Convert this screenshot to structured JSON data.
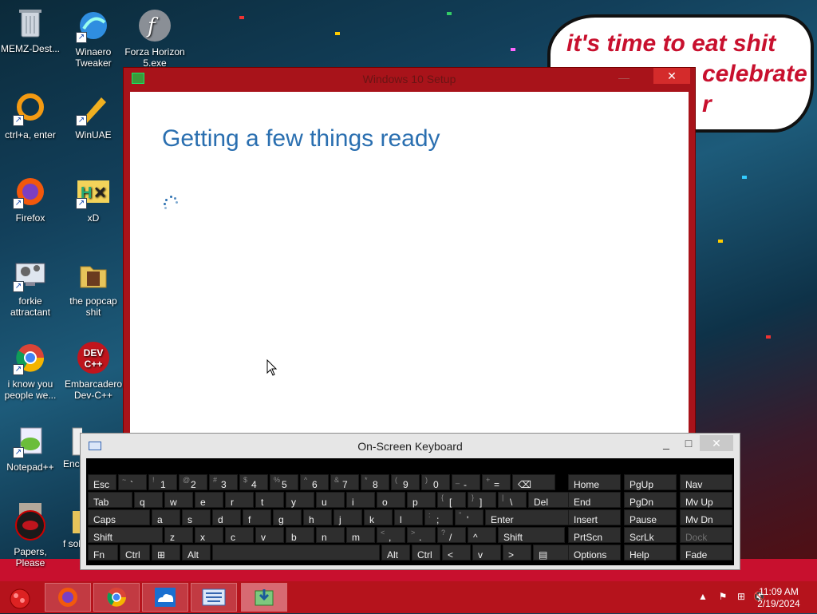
{
  "wallpaper": {
    "speech_bubble_text": "it's time to eat shit and celebrate",
    "speech_bubble_line1": "it's time to eat shit",
    "speech_bubble_line2": "celebrate",
    "speech_bubble_line3": "r"
  },
  "desktop_icons": [
    {
      "label": "MEMZ-Dest...",
      "icon": "recycle-bin-icon"
    },
    {
      "label": "Winaero Tweaker",
      "icon": "winaero-icon"
    },
    {
      "label": "Forza Horizon 5.exe",
      "icon": "flash-icon"
    },
    {
      "label": "ctrl+a, enter",
      "icon": "orange-ring-icon"
    },
    {
      "label": "WinUAE",
      "icon": "pencil-icon"
    },
    {
      "label": "Firefox",
      "icon": "firefox-icon"
    },
    {
      "label": "xD",
      "icon": "hxd-icon"
    },
    {
      "label": "forkie attractant",
      "icon": "settings-monitor-icon"
    },
    {
      "label": "the popcap shit",
      "icon": "folder-icon"
    },
    {
      "label": "i know you people we...",
      "icon": "chrome-icon"
    },
    {
      "label": "Embarcadero Dev-C++",
      "icon": "devcpp-icon"
    },
    {
      "label": "Notepad++",
      "icon": "notepadpp-icon"
    },
    {
      "label": "Enc",
      "icon": "document-icon"
    },
    {
      "label": "Papers, Please",
      "icon": "papers-please-icon"
    },
    {
      "label": "f sol",
      "icon": "folder-icon"
    }
  ],
  "setup_window": {
    "title": "Windows 10 Setup",
    "heading": "Getting a few things ready",
    "close_symbol": "✕",
    "minimize_symbol": "—"
  },
  "osk": {
    "title": "On-Screen Keyboard",
    "minimize_symbol": "_",
    "maximize_symbol": "□",
    "close_symbol": "✕",
    "row1": [
      {
        "main": "Esc"
      },
      {
        "sub": "~",
        "main": "`"
      },
      {
        "sub": "!",
        "main": "1"
      },
      {
        "sub": "@",
        "main": "2"
      },
      {
        "sub": "#",
        "main": "3"
      },
      {
        "sub": "$",
        "main": "4"
      },
      {
        "sub": "%",
        "main": "5"
      },
      {
        "sub": "^",
        "main": "6"
      },
      {
        "sub": "&",
        "main": "7"
      },
      {
        "sub": "*",
        "main": "8"
      },
      {
        "sub": "(",
        "main": "9"
      },
      {
        "sub": ")",
        "main": "0"
      },
      {
        "sub": "_",
        "main": "-"
      },
      {
        "sub": "+",
        "main": "="
      },
      {
        "main": "⌫"
      }
    ],
    "row2": [
      {
        "main": "Tab"
      },
      {
        "main": "q"
      },
      {
        "main": "w"
      },
      {
        "main": "e"
      },
      {
        "main": "r"
      },
      {
        "main": "t"
      },
      {
        "main": "y"
      },
      {
        "main": "u"
      },
      {
        "main": "i"
      },
      {
        "main": "o"
      },
      {
        "main": "p"
      },
      {
        "sub": "{",
        "main": "["
      },
      {
        "sub": "}",
        "main": "]"
      },
      {
        "sub": "|",
        "main": "\\"
      },
      {
        "main": "Del"
      }
    ],
    "row3": [
      {
        "main": "Caps"
      },
      {
        "main": "a"
      },
      {
        "main": "s"
      },
      {
        "main": "d"
      },
      {
        "main": "f"
      },
      {
        "main": "g"
      },
      {
        "main": "h"
      },
      {
        "main": "j"
      },
      {
        "main": "k"
      },
      {
        "main": "l"
      },
      {
        "sub": ":",
        "main": ";"
      },
      {
        "sub": "\"",
        "main": "'"
      },
      {
        "main": "Enter"
      }
    ],
    "row4": [
      {
        "main": "Shift"
      },
      {
        "main": "z"
      },
      {
        "main": "x"
      },
      {
        "main": "c"
      },
      {
        "main": "v"
      },
      {
        "main": "b"
      },
      {
        "main": "n"
      },
      {
        "main": "m"
      },
      {
        "sub": "<",
        "main": ","
      },
      {
        "sub": ">",
        "main": "."
      },
      {
        "sub": "?",
        "main": "/"
      },
      {
        "main": "^"
      },
      {
        "main": "Shift"
      }
    ],
    "row5": [
      {
        "main": "Fn"
      },
      {
        "main": "Ctrl"
      },
      {
        "main": "⊞"
      },
      {
        "main": "Alt"
      },
      {
        "main": ""
      },
      {
        "main": "Alt"
      },
      {
        "main": "Ctrl"
      },
      {
        "main": "<"
      },
      {
        "main": "v"
      },
      {
        "main": ">"
      },
      {
        "main": "▤"
      }
    ],
    "nav_cols": [
      [
        "Home",
        "End",
        "Insert",
        "PrtScn",
        "Options"
      ],
      [
        "PgUp",
        "PgDn",
        "Pause",
        "ScrLk",
        "Help"
      ],
      [
        "Nav",
        "Mv Up",
        "Mv Dn",
        "Dock",
        "Fade"
      ]
    ]
  },
  "taskbar": {
    "items": [
      "firefox-icon",
      "chrome-icon",
      "onedrive-icon",
      "osk-icon",
      "setup-icon"
    ],
    "time": "11:09 AM",
    "date": "2/19/2024"
  }
}
